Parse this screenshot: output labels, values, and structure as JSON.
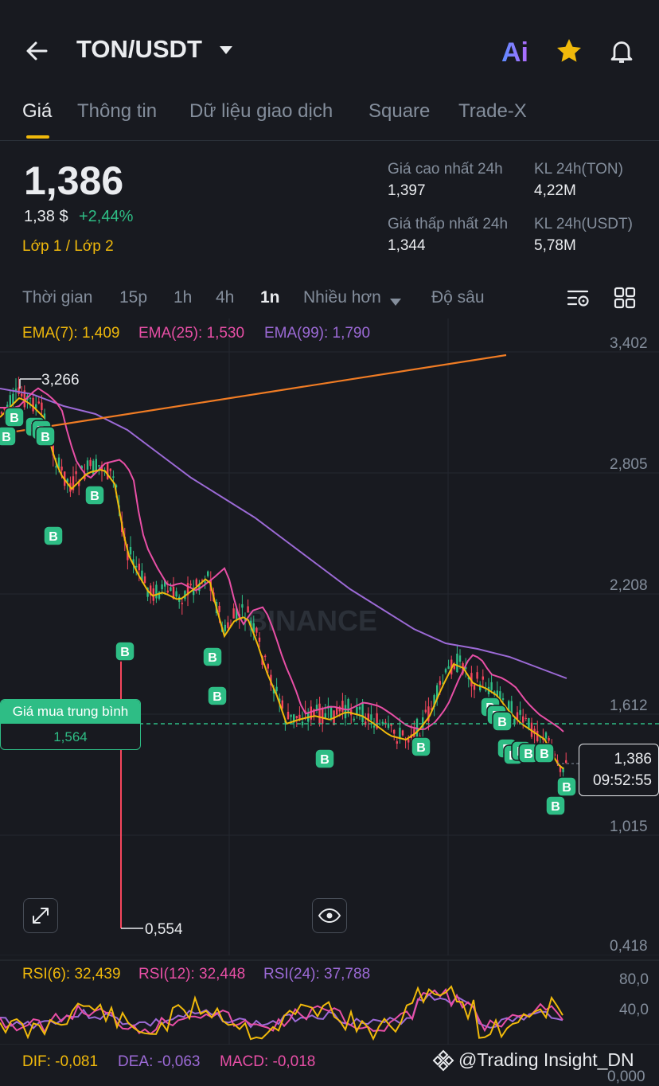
{
  "header": {
    "pair": "TON/USDT"
  },
  "tabs": [
    "Giá",
    "Thông tin",
    "Dữ liệu giao dịch",
    "Square",
    "Trade-X"
  ],
  "price": {
    "last": "1,386",
    "usd": "1,38 $",
    "change": "+2,44%",
    "layer": "Lớp 1 / Lớp 2"
  },
  "stats": {
    "high_label": "Giá cao nhất 24h",
    "high": "1,397",
    "vol_ton_label": "KL 24h(TON)",
    "vol_ton": "4,22M",
    "low_label": "Giá thấp nhất 24h",
    "low": "1,344",
    "vol_usdt_label": "KL 24h(USDT)",
    "vol_usdt": "5,78M"
  },
  "timeframes": [
    "Thời gian",
    "15p",
    "1h",
    "4h",
    "1n",
    "Nhiều hơn",
    "Độ sâu"
  ],
  "active_timeframe": "1n",
  "ema": {
    "e7": "EMA(7): 1,409",
    "e25": "EMA(25): 1,530",
    "e99": "EMA(99): 1,790"
  },
  "colors": {
    "up": "#2ebd85",
    "down": "#f6465d",
    "ema7": "#f0b90b",
    "ema25": "#e84fa6",
    "ema99": "#9c6ad6",
    "trend": "#f07c24"
  },
  "chart": {
    "y_ticks": [
      "3,402",
      "2,805",
      "2,208",
      "1,612",
      "1,015",
      "0,418"
    ],
    "high_marker": "3,266",
    "low_marker": "0,554",
    "avg_label": "Giá mua trung bình",
    "avg_value": "1,564",
    "current_price": "1,386",
    "countdown": "09:52:55",
    "watermark": "BINANCE",
    "buy_marker": "B"
  },
  "rsi": {
    "r6": "RSI(6): 32,439",
    "r12": "RSI(12): 32,448",
    "r24": "RSI(24): 37,788",
    "ticks": [
      "80,0",
      "40,0"
    ]
  },
  "macd": {
    "dif": "DIF: -0,081",
    "dea": "DEA: -0,063",
    "macd": "MACD: -0,018",
    "tick": "0,000"
  },
  "credit": "@Trading Insight_DN",
  "chart_data": {
    "type": "candlestick",
    "ylim": [
      0.418,
      3.402
    ],
    "high": 3.266,
    "low": 0.554,
    "avg_buy": 1.564,
    "last": 1.386
  }
}
